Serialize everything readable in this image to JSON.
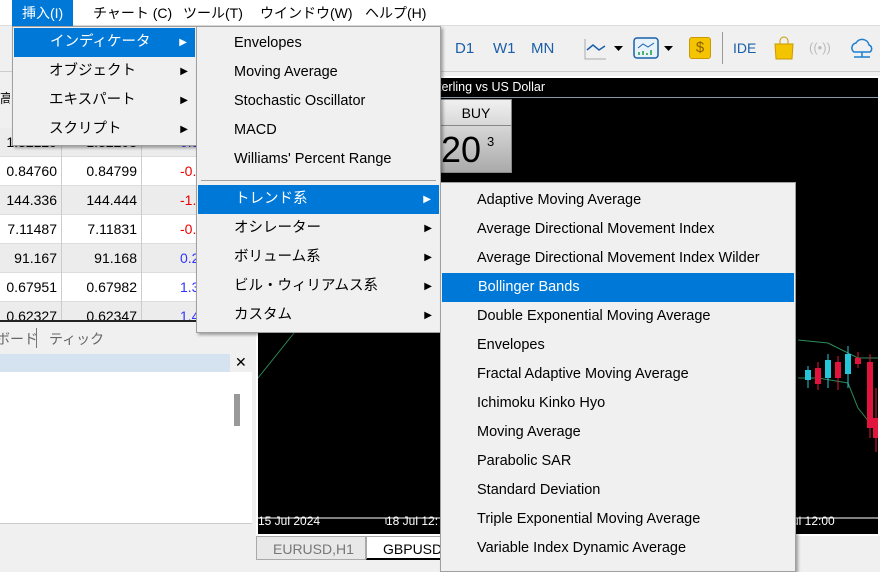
{
  "menubar": {
    "items": [
      "挿入(I)",
      "チャート (C)",
      "ツール(T)",
      "ウインドウ(W)",
      "ヘルプ(H)"
    ],
    "active": "挿入(I)"
  },
  "toolbar": {
    "timeframes": [
      "D1",
      "W1",
      "MN"
    ],
    "ide_label": "IDE",
    "icons": [
      "line-chart-icon",
      "indicator-chart-icon",
      "dollar-icon",
      "market-bag-icon",
      "signal-icon",
      "cloud-icon"
    ]
  },
  "market_watch": {
    "rows": [
      [
        "1.32129",
        "1.32203",
        "0.5"
      ],
      [
        "0.84760",
        "0.84799",
        "-0.5"
      ],
      [
        "144.336",
        "144.444",
        "-1.2"
      ],
      [
        "7.11487",
        "7.11831",
        "-0.4"
      ],
      [
        "91.167",
        "91.168",
        "0.2"
      ],
      [
        "0.67951",
        "0.67982",
        "1.3"
      ],
      [
        "0.62327",
        "0.62347",
        "1.4"
      ]
    ],
    "tabs": [
      "ボード",
      "ティック"
    ],
    "partial_header": "高気"
  },
  "chart": {
    "title": "terling vs US Dollar",
    "buy_label": "BUY",
    "price_big": "20",
    "price_sup": "3",
    "time_labels": [
      "15 Jul 2024",
      "18 Jul 12:",
      "ul 12:00"
    ],
    "tabs": [
      "EURUSD,H1",
      "GBPUSD"
    ],
    "colors": {
      "bull": "#26c6da",
      "bear": "#e0143c",
      "band": "#2e8b57"
    }
  },
  "menu_insert": {
    "items": [
      "インディケータ",
      "オブジェクト",
      "エキスパート",
      "スクリプト"
    ],
    "highlighted": "インディケータ"
  },
  "menu_indicators": {
    "recent": [
      "Envelopes",
      "Moving Average",
      "Stochastic Oscillator",
      "MACD",
      "Williams' Percent Range"
    ],
    "groups": [
      "トレンド系",
      "オシレーター",
      "ボリューム系",
      "ビル・ウィリアムス系",
      "カスタム"
    ],
    "highlighted": "トレンド系"
  },
  "menu_trend": {
    "items": [
      "Adaptive Moving Average",
      "Average Directional Movement Index",
      "Average Directional Movement Index Wilder",
      "Bollinger Bands",
      "Double Exponential Moving Average",
      "Envelopes",
      "Fractal Adaptive Moving Average",
      "Ichimoku Kinko Hyo",
      "Moving Average",
      "Parabolic SAR",
      "Standard Deviation",
      "Triple Exponential Moving Average",
      "Variable Index Dynamic Average"
    ],
    "highlighted": "Bollinger Bands"
  },
  "accent": "#0078d7"
}
